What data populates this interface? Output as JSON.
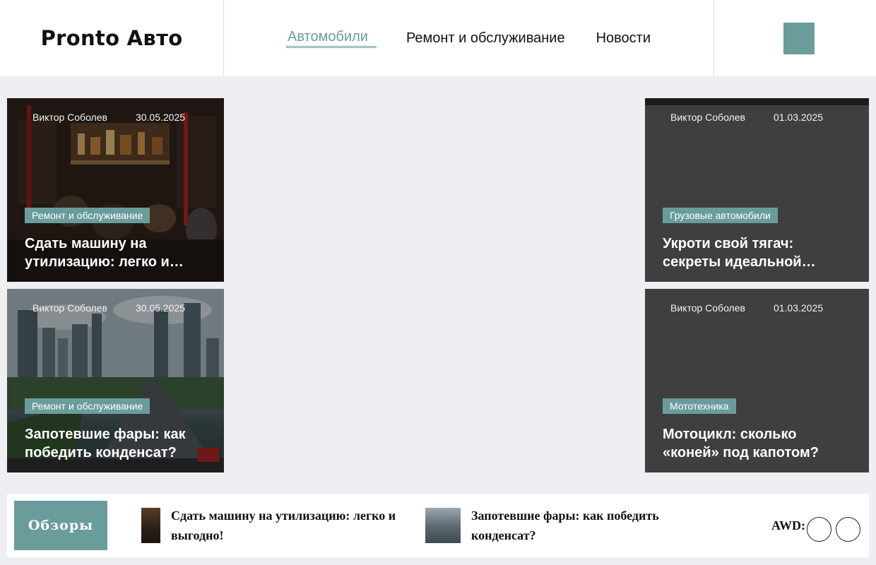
{
  "header": {
    "logo": "Pronto Авто",
    "nav": [
      {
        "label": "Автомобили",
        "active": true
      },
      {
        "label": "Ремонт и обслуживание",
        "active": false
      },
      {
        "label": "Новости",
        "active": false
      }
    ]
  },
  "cards": [
    {
      "author": "Виктор Соболев",
      "date": "30.05.2025",
      "tag": "Ремонт и обслуживание",
      "title": "Сдать машину на утилизацию: легко и…"
    },
    {
      "author": "Виктор Соболев",
      "date": "30.05.2025",
      "tag": "Ремонт и обслуживание",
      "title": "Запотевшие фары: как победить конденсат?"
    },
    {
      "author": "Виктор Соболев",
      "date": "01.03.2025",
      "tag": "Грузовые автомобили",
      "title": "Укроти свой тягач: секреты идеальной…"
    },
    {
      "author": "Виктор Соболев",
      "date": "01.03.2025",
      "tag": "Мототехника",
      "title": "Мотоцикл: сколько «коней» под капотом?"
    }
  ],
  "reviews": {
    "label": "Обзоры",
    "items": [
      {
        "title": "Сдать машину на утилизацию: легко и выгодно!"
      },
      {
        "title": "Запотевшие фары: как победить конденсат?"
      },
      {
        "title": "AWD: … вам г…"
      }
    ]
  },
  "colors": {
    "accent": "#6a9c9c",
    "dark_card": "#3f3f3f"
  }
}
